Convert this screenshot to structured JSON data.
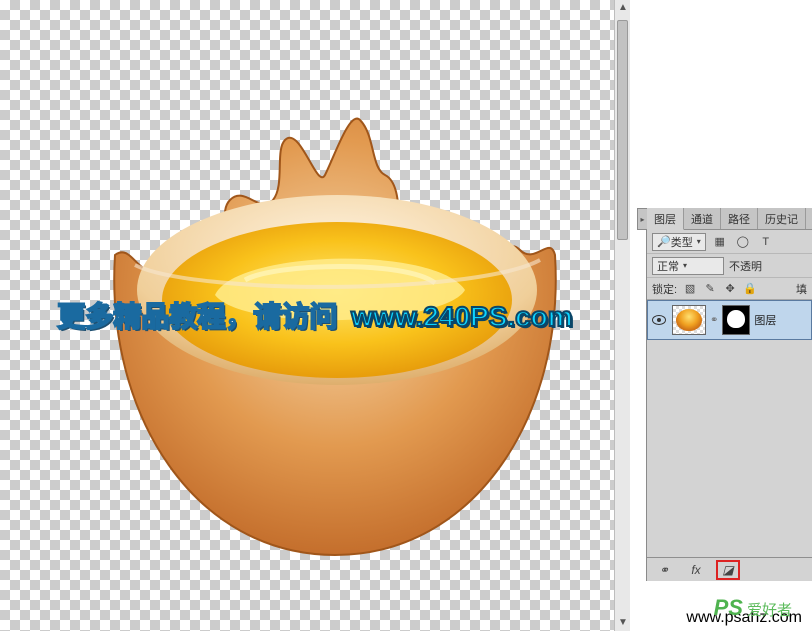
{
  "overlay": {
    "text_main": "更多精品教程，请访问",
    "text_url": "www.240PS.com"
  },
  "panel": {
    "tabs": [
      "图层",
      "通道",
      "路径",
      "历史记"
    ],
    "type_row": {
      "kind_label": "类型",
      "filter_icons": [
        "▦",
        "◯",
        "T"
      ]
    },
    "blend_row": {
      "mode": "正常",
      "opacity_label": "不透明"
    },
    "lock_row": {
      "label": "锁定:",
      "fill_label": "填"
    },
    "layer": {
      "name": "图层"
    },
    "footer_icons": [
      "⚭",
      "fx",
      "◪"
    ]
  },
  "watermark": {
    "logo": "PS",
    "name": "爱好者",
    "url": "www.psahz.com"
  }
}
